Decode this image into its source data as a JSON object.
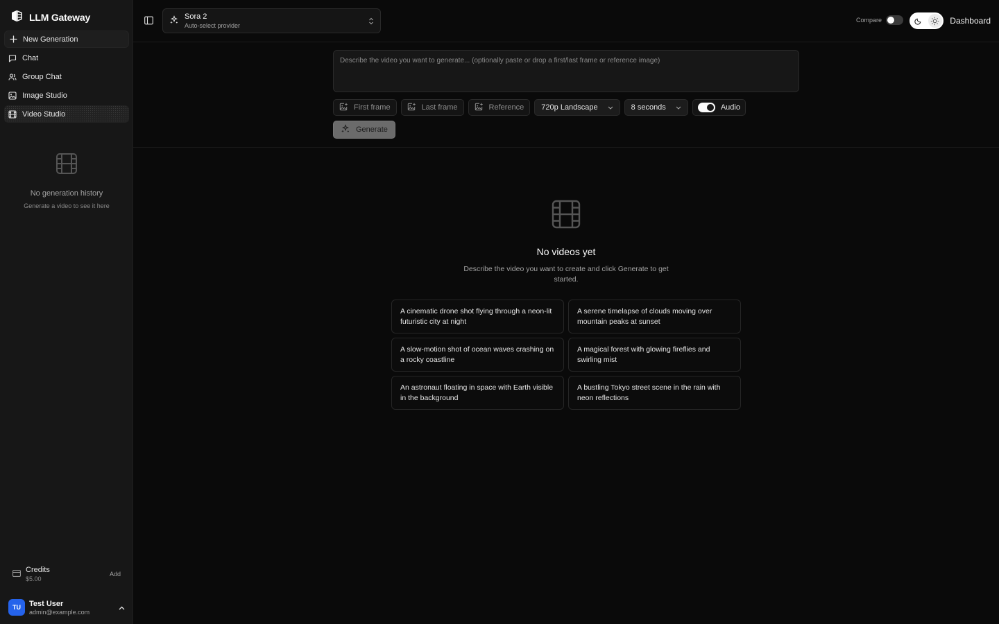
{
  "app": {
    "title": "LLM Gateway"
  },
  "sidebar": {
    "items": [
      {
        "label": "New Generation",
        "icon": "plus-icon"
      },
      {
        "label": "Chat",
        "icon": "message-icon"
      },
      {
        "label": "Group Chat",
        "icon": "users-icon"
      },
      {
        "label": "Image Studio",
        "icon": "image-icon"
      },
      {
        "label": "Video Studio",
        "icon": "film-icon",
        "active": true
      }
    ],
    "history_empty": {
      "title": "No generation history",
      "subtitle": "Generate a video to see it here"
    },
    "credits": {
      "label": "Credits",
      "amount": "$5.00",
      "add_label": "Add"
    },
    "user": {
      "initials": "TU",
      "name": "Test User",
      "email": "admin@example.com"
    }
  },
  "header": {
    "model": {
      "name": "Sora 2",
      "provider": "Auto-select provider"
    },
    "compare_label": "Compare",
    "compare_on": false,
    "dashboard_label": "Dashboard"
  },
  "composer": {
    "placeholder": "Describe the video you want to generate... (optionally paste or drop a first/last frame or reference image)",
    "first_frame_label": "First frame",
    "last_frame_label": "Last frame",
    "reference_label": "Reference",
    "resolution": "720p Landscape",
    "duration": "8 seconds",
    "audio_label": "Audio",
    "audio_on": true,
    "generate_label": "Generate"
  },
  "empty_state": {
    "title": "No videos yet",
    "description": "Describe the video you want to create and click Generate to get started.",
    "suggestions": [
      "A cinematic drone shot flying through a neon-lit futuristic city at night",
      "A serene timelapse of clouds moving over mountain peaks at sunset",
      "A slow-motion shot of ocean waves crashing on a rocky coastline",
      "A magical forest with glowing fireflies and swirling mist",
      "An astronaut floating in space with Earth visible in the background",
      "A bustling Tokyo street scene in the rain with neon reflections"
    ]
  },
  "colors": {
    "background": "#0a0a0a",
    "sidebar": "#171717",
    "border": "#2a2a2a",
    "avatar": "#2563eb",
    "text_muted": "#a3a3a3"
  }
}
